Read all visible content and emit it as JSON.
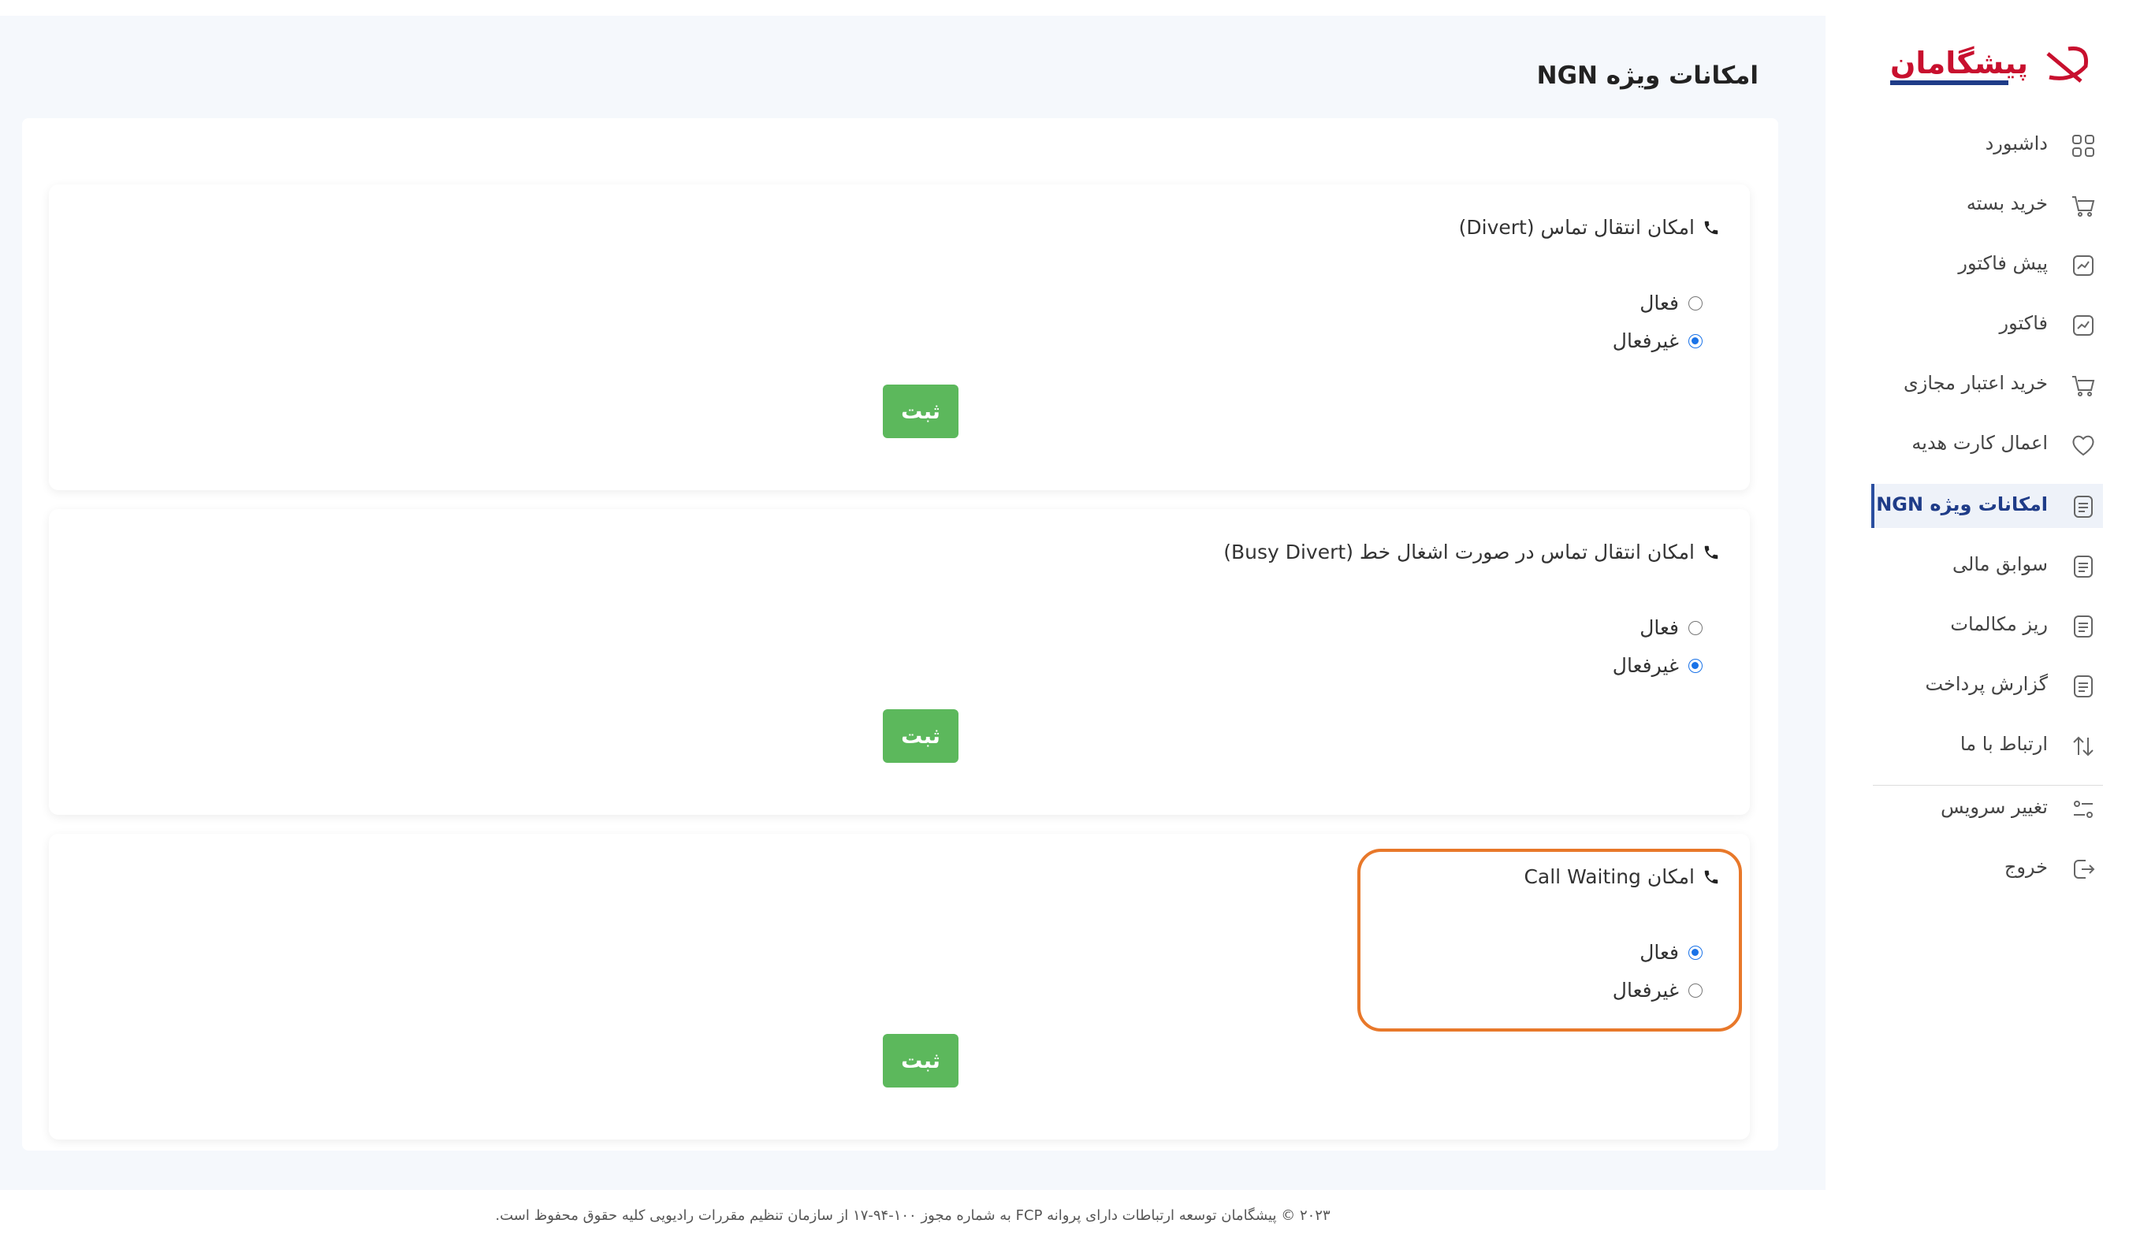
{
  "page": {
    "title": "امکانات ویژه NGN"
  },
  "sections": [
    {
      "title": "امکان انتقال تماس (Divert)",
      "options": [
        {
          "label": "فعال",
          "checked": false
        },
        {
          "label": "غیرفعال",
          "checked": true
        }
      ],
      "submit_label": "ثبت"
    },
    {
      "title": "امکان انتقال تماس در صورت اشغال خط (Busy Divert)",
      "options": [
        {
          "label": "فعال",
          "checked": false
        },
        {
          "label": "غیرفعال",
          "checked": true
        }
      ],
      "submit_label": "ثبت"
    },
    {
      "title": "امکان Call Waiting",
      "options": [
        {
          "label": "فعال",
          "checked": true
        },
        {
          "label": "غیرفعال",
          "checked": false
        }
      ],
      "submit_label": "ثبت"
    }
  ],
  "sidebar": {
    "logo_text": "پیشگامان",
    "items": [
      {
        "label": "داشبورد",
        "icon": "dashboard-icon"
      },
      {
        "label": "خرید بسته",
        "icon": "cart-icon"
      },
      {
        "label": "پیش فاکتور",
        "icon": "chart-icon"
      },
      {
        "label": "فاکتور",
        "icon": "chart-icon"
      },
      {
        "label": "خرید اعتبار مجازی",
        "icon": "cart-icon"
      },
      {
        "label": "اعمال کارت هدیه",
        "icon": "heart-icon"
      },
      {
        "label": "امکانات ویژه NGN",
        "icon": "document-icon",
        "active": true
      },
      {
        "label": "سوابق مالی",
        "icon": "document-icon"
      },
      {
        "label": "ریز مکالمات",
        "icon": "document-icon"
      },
      {
        "label": "گزارش پرداخت",
        "icon": "document-icon"
      },
      {
        "label": "ارتباط با ما",
        "icon": "arrows-icon"
      },
      {
        "label": "تغییر سرویس",
        "icon": "settings-icon"
      },
      {
        "label": "خروج",
        "icon": "logout-icon"
      }
    ]
  },
  "footer": {
    "text": "۲۰۲۳ © پیشگامان توسعه ارتباطات دارای پروانه FCP به شماره مجوز ۱۰۰-۹۴-۱۷ از سازمان تنظیم مقررات رادیویی کلیه حقوق محفوظ است."
  },
  "colors": {
    "accent": "#2b4fa0",
    "submit": "#5cb85c",
    "highlight": "#e8782a",
    "radio": "#1a73e8"
  }
}
